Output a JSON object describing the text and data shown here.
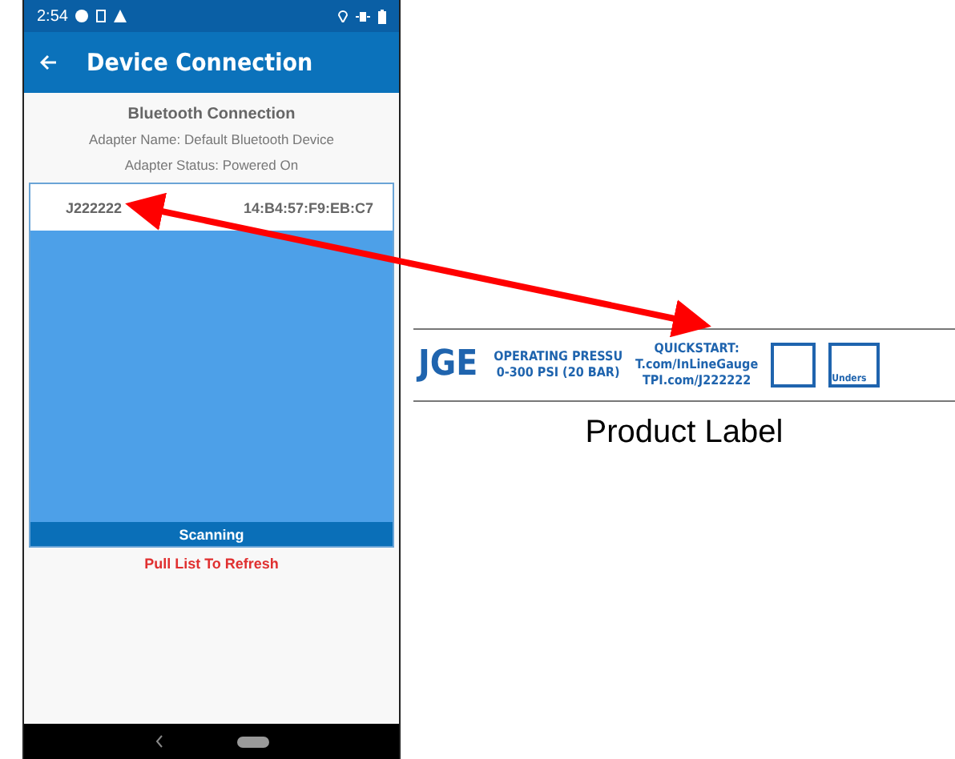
{
  "phone": {
    "status_bar": {
      "time": "2:54"
    },
    "app_bar": {
      "title": "Device Connection"
    },
    "section_title": "Bluetooth Connection",
    "adapter_name": "Adapter Name: Default Bluetooth Device",
    "adapter_status": "Adapter Status: Powered On",
    "devices": [
      {
        "name": "J222222",
        "address": "14:B4:57:F9:EB:C7"
      }
    ],
    "scan_status": "Scanning",
    "refresh_hint": "Pull List To Refresh"
  },
  "product_label": {
    "brand_fragment": "JGE",
    "pressure_title": "OPERATING PRESSU",
    "pressure_range": "0-300 PSI (20 BAR)",
    "quickstart_title": "QUICKSTART:",
    "quickstart_line_1": "T.com/InLineGauge",
    "quickstart_line_2": "TPI.com/J222222",
    "cut_text": "Unders"
  },
  "caption": "Product Label"
}
